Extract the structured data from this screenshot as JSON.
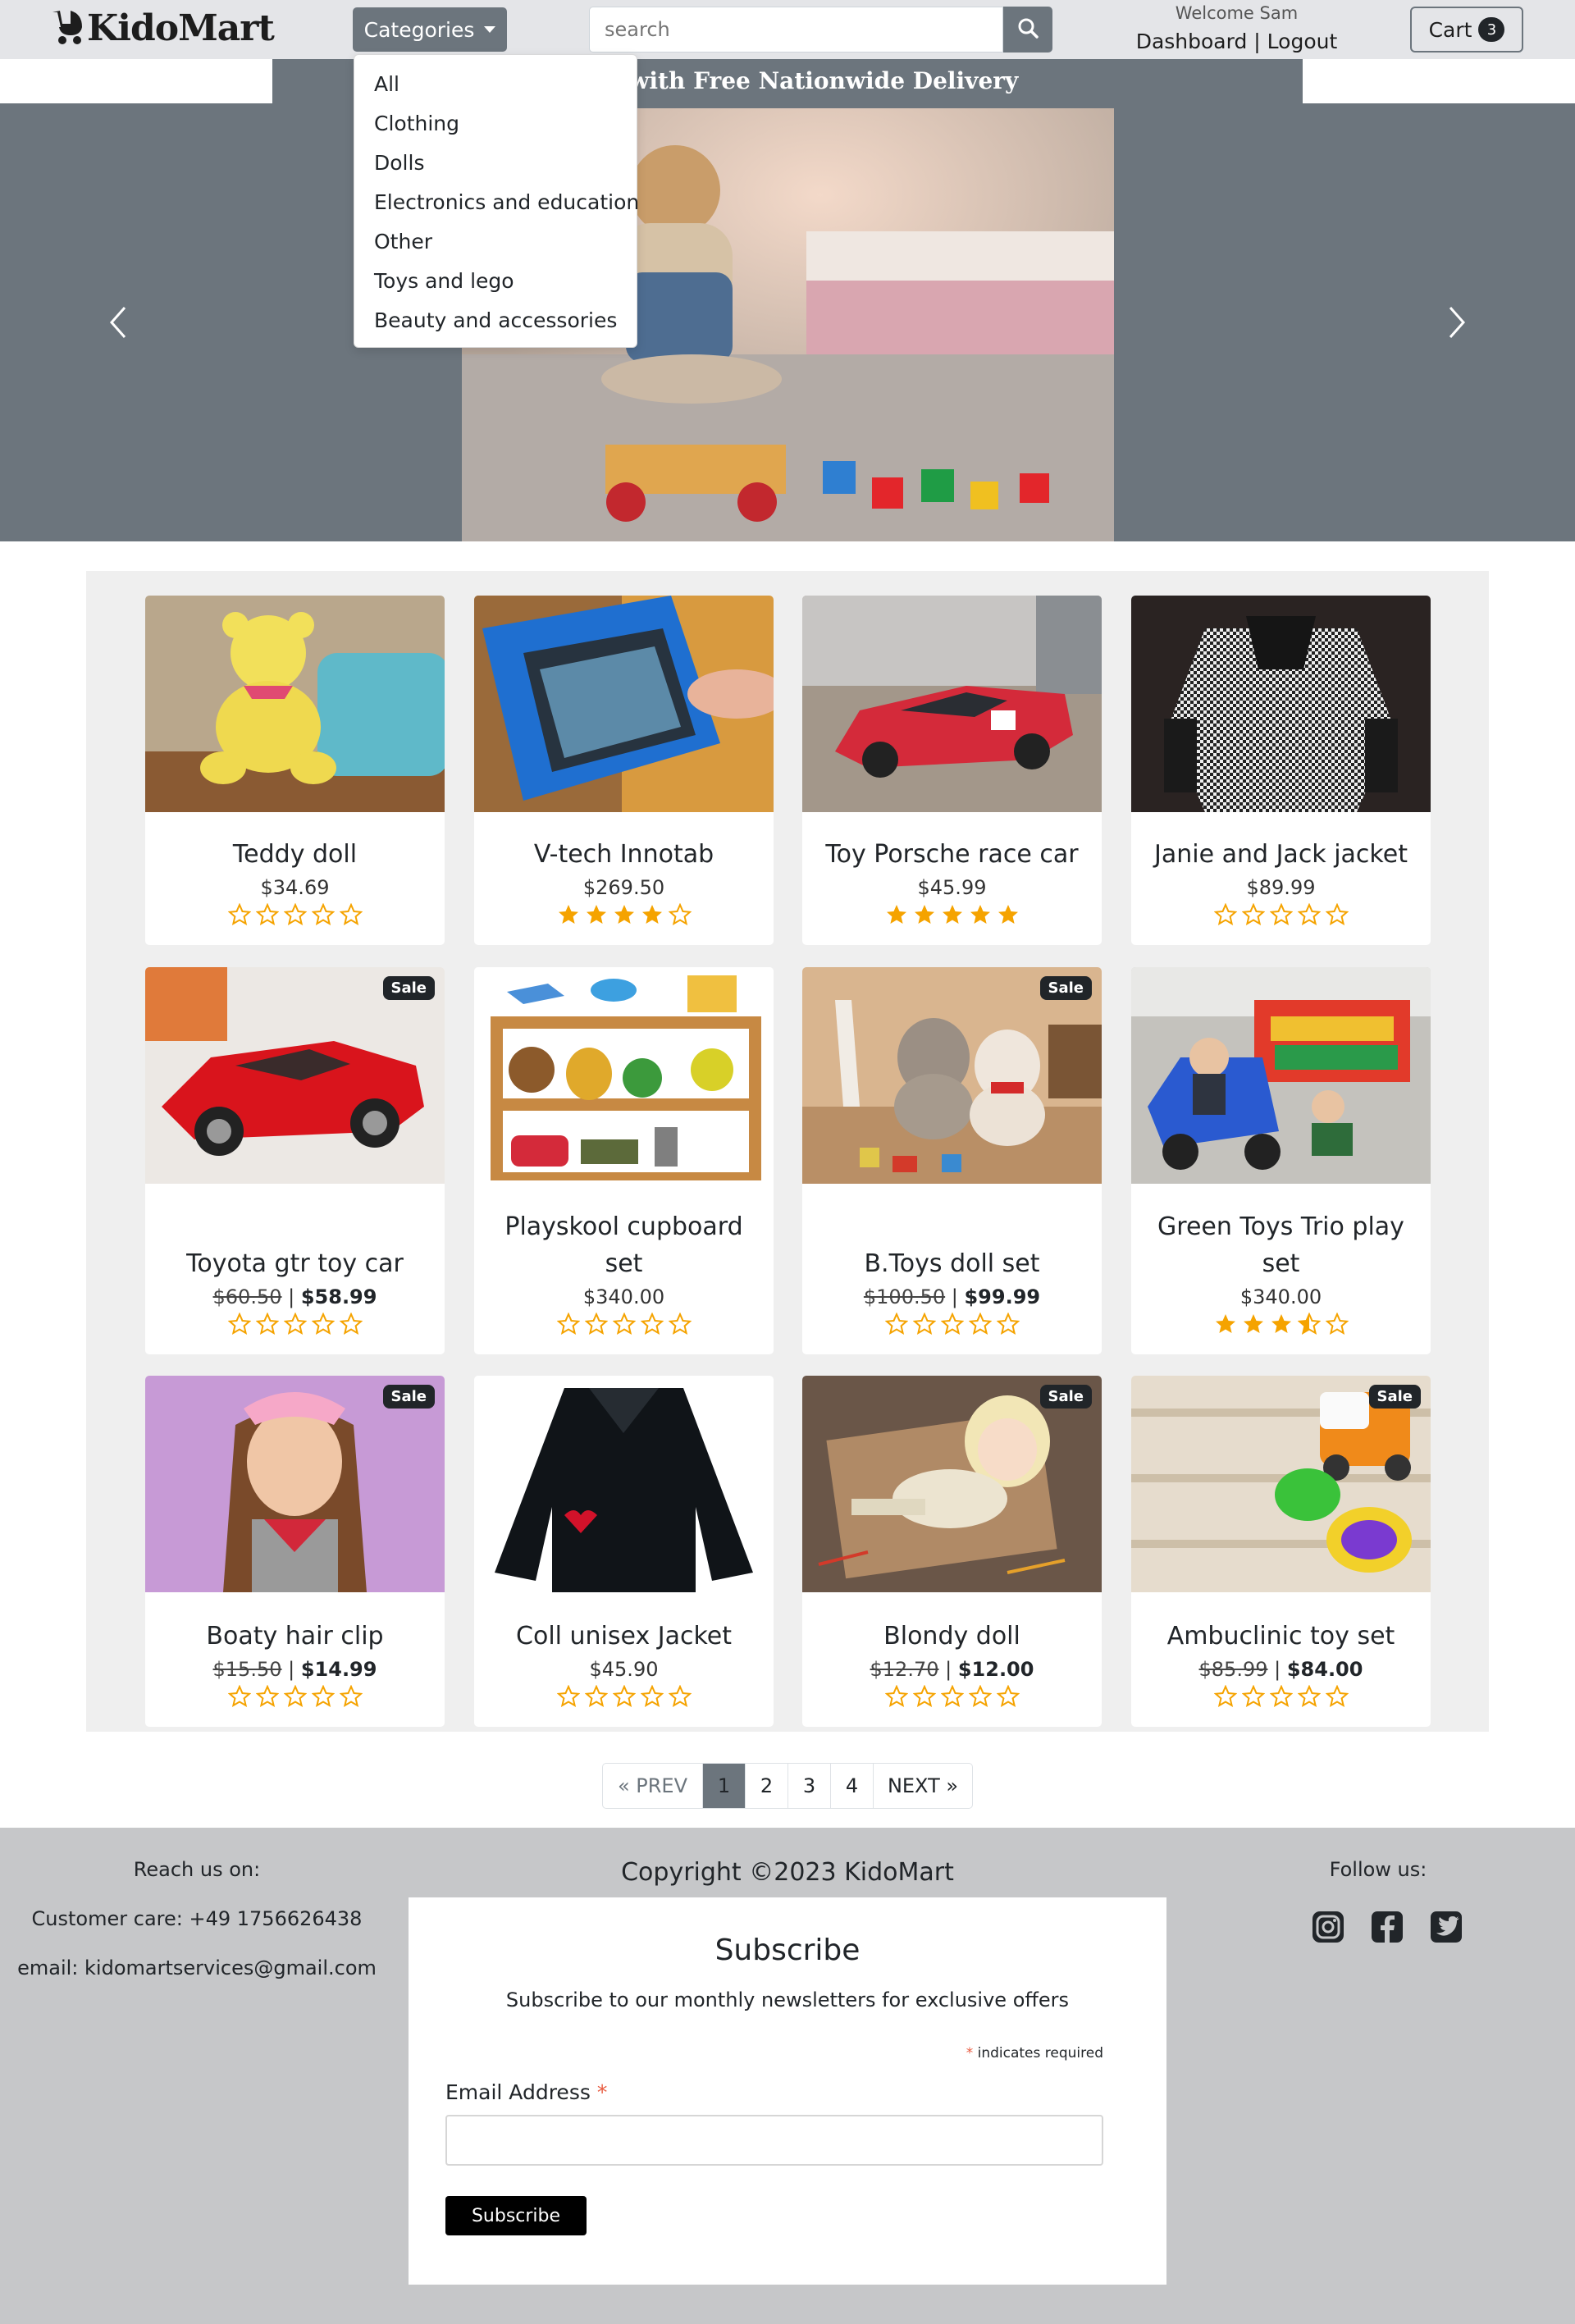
{
  "navbar": {
    "logo_text": "KidoMart",
    "categories_label": "Categories",
    "search_placeholder": "search",
    "welcome_text": "Welcome Sam",
    "dashboard_label": "Dashboard",
    "separator": " | ",
    "logout_label": "Logout",
    "cart_label": "Cart",
    "cart_count": "3"
  },
  "categories_menu": {
    "items": [
      "All",
      "Clothing",
      "Dolls",
      "Electronics and education",
      "Other",
      "Toys and lego",
      "Beauty and accessories"
    ]
  },
  "hero": {
    "banner_text": "Shop with Free Nationwide Delivery"
  },
  "products": [
    {
      "name": "Teddy doll",
      "price": "$34.69",
      "old_price": "",
      "new_price": "",
      "sale": false,
      "rating": 0
    },
    {
      "name": "V-tech Innotab",
      "price": "$269.50",
      "old_price": "",
      "new_price": "",
      "sale": false,
      "rating": 4
    },
    {
      "name": "Toy Porsche race car",
      "price": "$45.99",
      "old_price": "",
      "new_price": "",
      "sale": false,
      "rating": 5
    },
    {
      "name": "Janie and Jack jacket",
      "price": "$89.99",
      "old_price": "",
      "new_price": "",
      "sale": false,
      "rating": 0
    },
    {
      "name": "Toyota gtr toy car",
      "price": "",
      "old_price": "$60.50",
      "new_price": "$58.99",
      "sale": true,
      "rating": 0
    },
    {
      "name": "Playskool cupboard set",
      "price": "$340.00",
      "old_price": "",
      "new_price": "",
      "sale": false,
      "rating": 0
    },
    {
      "name": "B.Toys doll set",
      "price": "",
      "old_price": "$100.50",
      "new_price": "$99.99",
      "sale": true,
      "rating": 0
    },
    {
      "name": "Green Toys Trio play set",
      "price": "$340.00",
      "old_price": "",
      "new_price": "",
      "sale": false,
      "rating": 3.5
    },
    {
      "name": "Boaty hair clip",
      "price": "",
      "old_price": "$15.50",
      "new_price": "$14.99",
      "sale": true,
      "rating": 0
    },
    {
      "name": "Coll unisex Jacket",
      "price": "$45.90",
      "old_price": "",
      "new_price": "",
      "sale": false,
      "rating": 0
    },
    {
      "name": "Blondy doll",
      "price": "",
      "old_price": "$12.70",
      "new_price": "$12.00",
      "sale": true,
      "rating": 0
    },
    {
      "name": "Ambuclinic toy set",
      "price": "",
      "old_price": "$85.99",
      "new_price": "$84.00",
      "sale": true,
      "rating": 0
    }
  ],
  "sale_label": "Sale",
  "price_separator": " | ",
  "pagination": {
    "prev_label": "« PREV",
    "pages": [
      "1",
      "2",
      "3",
      "4"
    ],
    "active_page": "1",
    "next_label": "NEXT »"
  },
  "footer": {
    "reach_label": "Reach us on:",
    "customer_care": "Customer care: +49 1756626438",
    "email_label": "email: ",
    "email": "kidomartservices@gmail.com",
    "copyright": "Copyright ©2023 KidoMart",
    "follow_label": "Follow us:",
    "socials": [
      "instagram-icon",
      "facebook-icon",
      "twitter-icon"
    ]
  },
  "subscribe": {
    "title": "Subscribe",
    "description": "Subscribe to our monthly newsletters for exclusive offers",
    "required_star": "*",
    "required_note": " indicates required",
    "email_label": "Email Address ",
    "button_label": "Subscribe"
  },
  "colors": {
    "navbar_bg": "#e4e5e8",
    "secondary": "#6c757d",
    "star": "#f5a300",
    "footer_bg": "#c6c7c9",
    "products_bg": "#efefef"
  }
}
